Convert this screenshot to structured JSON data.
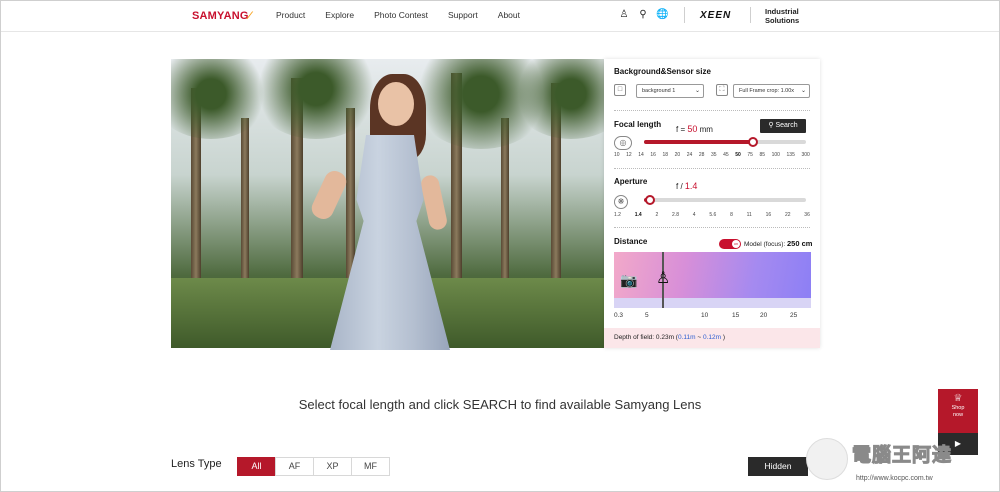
{
  "header": {
    "logo": "SAMYANG",
    "nav": [
      "Product",
      "Explore",
      "Photo Contest",
      "Support",
      "About"
    ],
    "icons": [
      "user-icon",
      "search-icon",
      "globe-icon"
    ],
    "xeen": "XEEN",
    "industrial": [
      "Industrial",
      "Solutions"
    ]
  },
  "panel": {
    "bg_title": "Background&Sensor size",
    "bg_select": "background 1",
    "sensor_select": "Full Frame crop: 1.00x",
    "focal_title": "Focal length",
    "focal_prefix": "f =",
    "focal_value": "50",
    "focal_unit": "mm",
    "search_label": "Search",
    "focal_ticks": [
      "10",
      "12",
      "14",
      "16",
      "18",
      "20",
      "24",
      "28",
      "35",
      "45",
      "50",
      "75",
      "85",
      "100",
      "135",
      "300"
    ],
    "focal_active": "50",
    "focal_fraction": 0.67,
    "aperture_title": "Aperture",
    "aperture_prefix": "f /",
    "aperture_value": "1.4",
    "aperture_ticks": [
      "1.2",
      "1.4",
      "2",
      "2.8",
      "4",
      "5.6",
      "8",
      "11",
      "16",
      "22",
      "36"
    ],
    "aperture_active": "1.4",
    "aperture_fraction": 0.04,
    "distance_title": "Distance",
    "toggle_text": "on",
    "model_label": "Model (focus):",
    "model_value": "250 cm",
    "distance_ticks": [
      "0.3",
      "5",
      "10",
      "15",
      "20",
      "25"
    ],
    "dof_label": "Depth of field: 0.23m (",
    "dof_near": "0.11m",
    "dof_sep": " ~ ",
    "dof_far": "0.12m",
    "dof_end": " )"
  },
  "caption": "Select focal length and click SEARCH to find available Samyang Lens",
  "lens_type": {
    "title": "Lens Type",
    "tabs": [
      "All",
      "AF",
      "XP",
      "MF"
    ],
    "active": "All"
  },
  "hidden_label": "Hidden",
  "shop": {
    "label1": "Shop",
    "label2": "now"
  },
  "watermark": {
    "text": "電腦王阿達",
    "url": "http://www.kocpc.com.tw"
  },
  "colors": {
    "brand": "#c8102e",
    "dark": "#2a2a2a",
    "dof_bg": "#fbe6e9",
    "dof_blue": "#2d5fd1"
  }
}
